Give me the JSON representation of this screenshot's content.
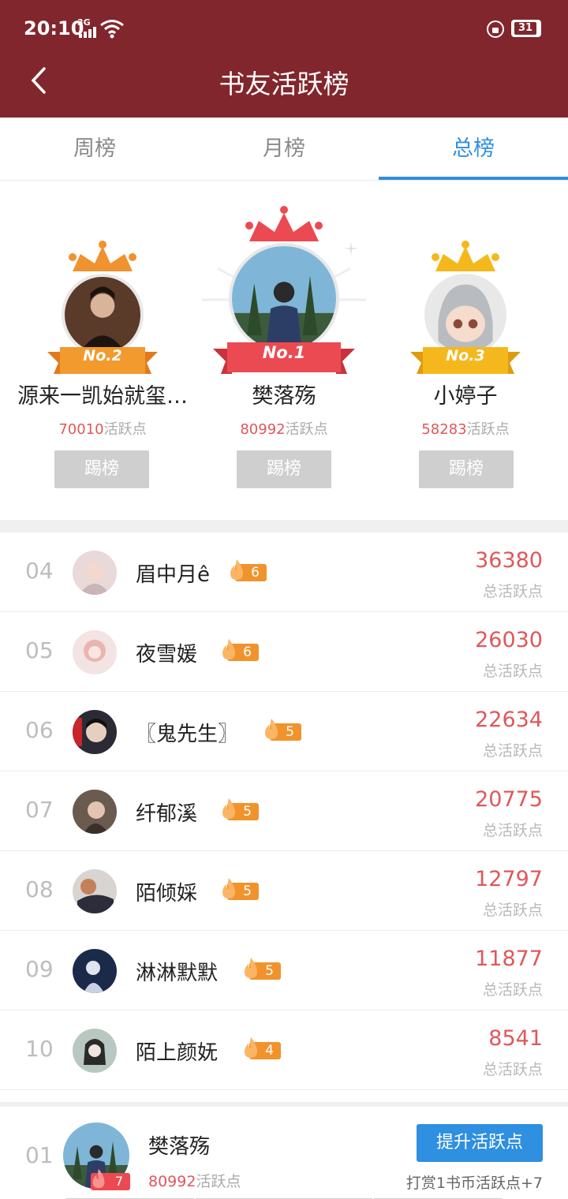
{
  "status": {
    "time": "20:10",
    "network": "3G",
    "battery": "31"
  },
  "header": {
    "title": "书友活跃榜"
  },
  "tabs": [
    {
      "label": "周榜"
    },
    {
      "label": "月榜"
    },
    {
      "label": "总榜",
      "active": true
    }
  ],
  "podium": {
    "second": {
      "name": "源来一凯始就玺…",
      "score": "70010",
      "score_suffix": "活跃点",
      "ribbon": "No.2",
      "kick": "踢榜"
    },
    "first": {
      "name": "樊落殇",
      "score": "80992",
      "score_suffix": "活跃点",
      "ribbon": "No.1",
      "kick": "踢榜"
    },
    "third": {
      "name": "小婷子",
      "score": "58283",
      "score_suffix": "活跃点",
      "ribbon": "No.3",
      "kick": "踢榜"
    }
  },
  "list": [
    {
      "rank": "04",
      "name": "眉中月ê",
      "level": "6",
      "score": "36380",
      "label": "总活跃点"
    },
    {
      "rank": "05",
      "name": "夜雪媛",
      "level": "6",
      "score": "26030",
      "label": "总活跃点"
    },
    {
      "rank": "06",
      "name": "〖鬼先生〗",
      "level": "5",
      "score": "22634",
      "label": "总活跃点"
    },
    {
      "rank": "07",
      "name": "纤郁溪",
      "level": "5",
      "score": "20775",
      "label": "总活跃点"
    },
    {
      "rank": "08",
      "name": "陌倾婇",
      "level": "5",
      "score": "12797",
      "label": "总活跃点"
    },
    {
      "rank": "09",
      "name": "淋淋默默",
      "level": "5",
      "score": "11877",
      "label": "总活跃点"
    },
    {
      "rank": "10",
      "name": "陌上颜妩",
      "level": "4",
      "score": "8541",
      "label": "总活跃点"
    }
  ],
  "me": {
    "rank": "01",
    "name": "樊落殇",
    "level": "7",
    "score": "80992",
    "score_suffix": "活跃点",
    "boost_button": "提升活跃点",
    "hint": "打赏1书币活跃点+7"
  },
  "colors": {
    "header": "#81262d",
    "accent": "#2f8fe0",
    "score": "#e0575a",
    "badge": "#f1932d"
  }
}
